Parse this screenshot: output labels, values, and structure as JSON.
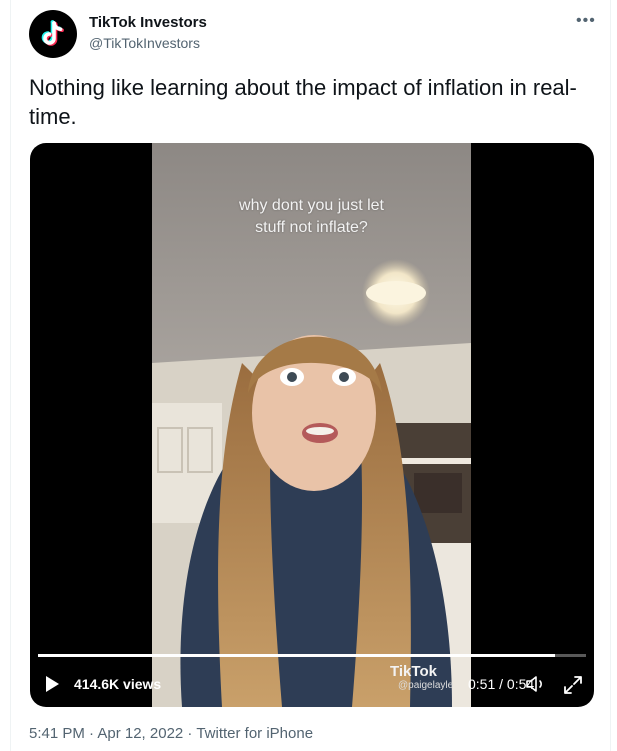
{
  "account": {
    "name": "TikTok Investors",
    "handle": "@TikTokInvestors",
    "avatar_icon": "tiktok-logo-icon"
  },
  "more_icon": "more-horizontal-icon",
  "tweet": {
    "text": "Nothing like learning about the impact of inflation in real-time."
  },
  "video": {
    "caption_line1": "why dont you just let",
    "caption_line2": "stuff not inflate?",
    "watermark_brand": "TikTok",
    "watermark_user": "@paigelayle",
    "views": "414.6K views",
    "current_time": "0:51",
    "duration": "0:54",
    "time_display": "0:51 / 0:54",
    "progress": 0.944,
    "icons": {
      "play": "play-icon",
      "volume": "volume-icon",
      "fullscreen": "fullscreen-icon"
    }
  },
  "meta": {
    "time": "5:41 PM",
    "date": "Apr 12, 2022",
    "source": "Twitter for iPhone",
    "line": "5:41 PM · Apr 12, 2022 · Twitter for iPhone"
  },
  "colors": {
    "text_primary": "#0f1419",
    "text_secondary": "#536471",
    "tiktok_cyan": "#25f4ee",
    "tiktok_red": "#fe2c55"
  }
}
